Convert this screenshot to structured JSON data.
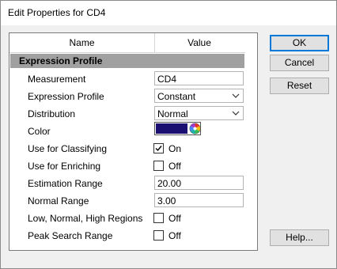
{
  "window": {
    "title": "Edit Properties for CD4"
  },
  "table": {
    "header_name": "Name",
    "header_value": "Value"
  },
  "section": {
    "title": "Expression Profile"
  },
  "rows": {
    "measurement": {
      "label": "Measurement",
      "value": "CD4"
    },
    "expression_profile": {
      "label": "Expression Profile",
      "value": "Constant"
    },
    "distribution": {
      "label": "Distribution",
      "value": "Normal"
    },
    "color": {
      "label": "Color",
      "swatch": "#1b1072"
    },
    "use_for_classifying": {
      "label": "Use for Classifying",
      "checked": true,
      "state": "On"
    },
    "use_for_enriching": {
      "label": "Use for Enriching",
      "checked": false,
      "state": "Off"
    },
    "estimation_range": {
      "label": "Estimation Range",
      "value": "20.00"
    },
    "normal_range": {
      "label": "Normal Range",
      "value": "3.00"
    },
    "low_normal_high": {
      "label": "Low, Normal, High Regions",
      "checked": false,
      "state": "Off"
    },
    "peak_search_range": {
      "label": "Peak Search Range",
      "checked": false,
      "state": "Off"
    }
  },
  "buttons": {
    "ok": "OK",
    "cancel": "Cancel",
    "reset": "Reset",
    "help": "Help..."
  },
  "colors": {
    "accent": "#0078d7",
    "section_bg": "#a0a0a0",
    "swatch": "#1b1072"
  }
}
